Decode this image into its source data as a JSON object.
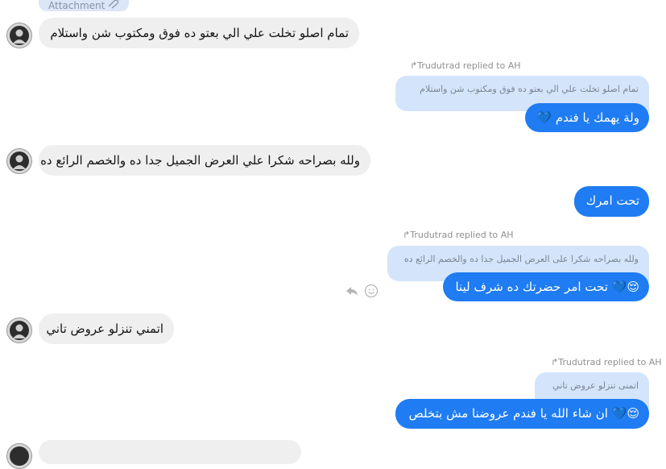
{
  "top": {
    "attachment_label": "Attachment"
  },
  "messages": {
    "m1": {
      "text": "تمام اصلو تخلت علي الي بعتو ده فوق ومكتوب شن واستلام"
    },
    "r1": {
      "header": "Trudutrad replied to AH",
      "quote": "تمام اصلو تخلت علي الي بعتو ده فوق ومكتوب شن واستلام",
      "text": "ولة يهمك يا فندم"
    },
    "m2": {
      "text": "ولله بصراحه شكرا علي العرض الجميل جدا ده والخصم الرائع ده"
    },
    "o1": {
      "text": "تحت امرك"
    },
    "r2": {
      "header": "Trudutrad replied to AH",
      "quote": "ولله بصراحه شكرا على العرض الجميل جدا ده والخصم الرائع ده",
      "text": "تحت امر حضرتك ده شرف لينا"
    },
    "m3": {
      "text": "اتمني تنزلو عروض تاني"
    },
    "r3": {
      "header": "Trudutrad replied to AH",
      "quote": "اتمنى تنزلو عروض تاني",
      "text": "ان شاء الله يا فندم عروضنا مش بتخلص"
    }
  },
  "colors": {
    "outgoing": "#1f7cf2",
    "incoming": "#efefef",
    "quote": "#d4e4fb"
  },
  "icons": [
    "attachment-clip-icon",
    "reply-arrow-icon",
    "emoji-smile-icon",
    "blue-heart-emoji",
    "relieved-face-emoji"
  ]
}
